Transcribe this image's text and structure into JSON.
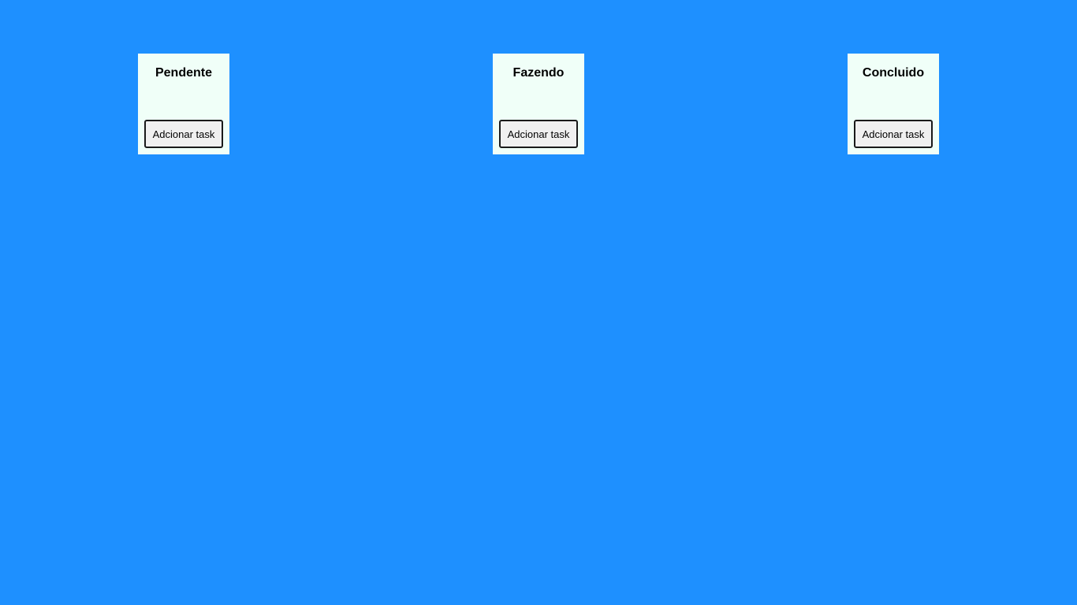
{
  "background_color": "#1e90ff",
  "column_color": "#f0fff8",
  "columns": [
    {
      "title": "Pendente",
      "button_label": "Adcionar task"
    },
    {
      "title": "Fazendo",
      "button_label": "Adcionar task"
    },
    {
      "title": "Concluido",
      "button_label": "Adcionar task"
    }
  ]
}
